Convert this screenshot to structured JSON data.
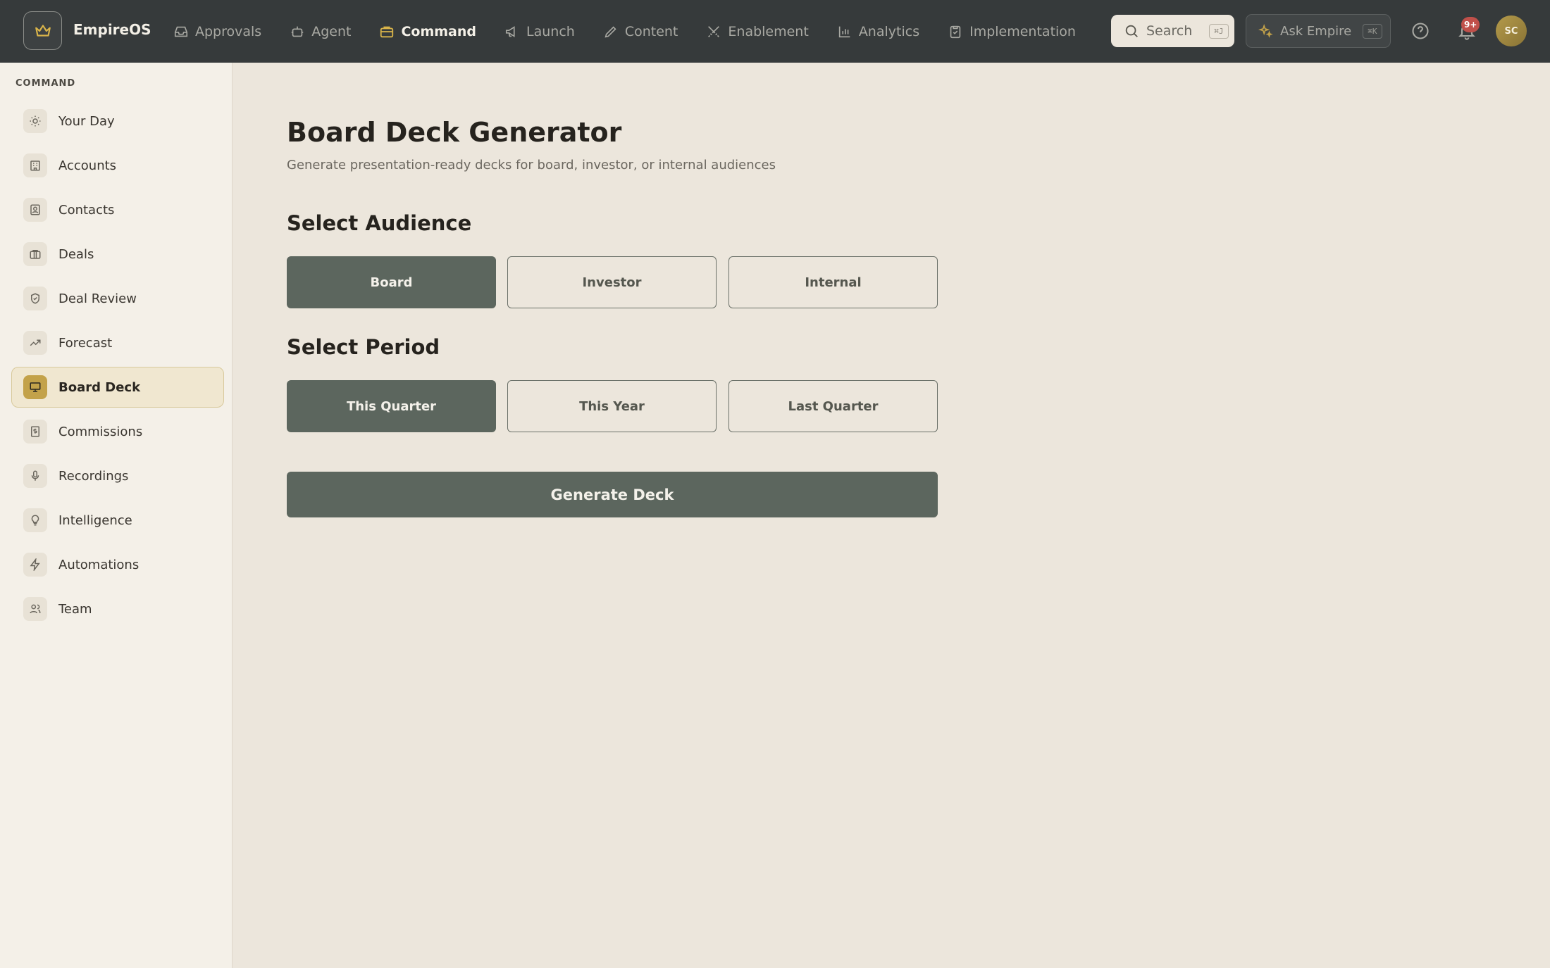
{
  "app": {
    "brand": "EmpireOS"
  },
  "nav": {
    "items": [
      {
        "label": "Approvals",
        "icon": "inbox-icon"
      },
      {
        "label": "Agent",
        "icon": "robot-icon"
      },
      {
        "label": "Command",
        "icon": "briefcase-icon",
        "active": true
      },
      {
        "label": "Launch",
        "icon": "megaphone-icon"
      },
      {
        "label": "Content",
        "icon": "pencil-icon"
      },
      {
        "label": "Enablement",
        "icon": "swords-icon"
      },
      {
        "label": "Analytics",
        "icon": "bar-chart-icon"
      },
      {
        "label": "Implementation",
        "icon": "clipboard-check-icon"
      }
    ]
  },
  "search": {
    "label": "Search",
    "shortcut": "⌘J"
  },
  "ask": {
    "label": "Ask Empire",
    "shortcut": "⌘K"
  },
  "notifications": {
    "badge": "9+"
  },
  "user": {
    "initials": "SC"
  },
  "sidebar": {
    "heading": "COMMAND",
    "items": [
      {
        "label": "Your Day",
        "icon": "sun-icon"
      },
      {
        "label": "Accounts",
        "icon": "building-icon"
      },
      {
        "label": "Contacts",
        "icon": "contact-card-icon"
      },
      {
        "label": "Deals",
        "icon": "briefcase-icon"
      },
      {
        "label": "Deal Review",
        "icon": "shield-check-icon"
      },
      {
        "label": "Forecast",
        "icon": "trending-up-icon"
      },
      {
        "label": "Board Deck",
        "icon": "presentation-icon",
        "active": true
      },
      {
        "label": "Commissions",
        "icon": "dollar-receipt-icon"
      },
      {
        "label": "Recordings",
        "icon": "microphone-icon"
      },
      {
        "label": "Intelligence",
        "icon": "lightbulb-icon"
      },
      {
        "label": "Automations",
        "icon": "lightning-icon"
      },
      {
        "label": "Team",
        "icon": "users-icon"
      }
    ]
  },
  "main": {
    "title": "Board Deck Generator",
    "subtitle": "Generate presentation-ready decks for board, investor, or internal audiences",
    "audience": {
      "heading": "Select Audience",
      "options": [
        "Board",
        "Investor",
        "Internal"
      ],
      "selected": "Board"
    },
    "period": {
      "heading": "Select Period",
      "options": [
        "This Quarter",
        "This Year",
        "Last Quarter"
      ],
      "selected": "This Quarter"
    },
    "generate_label": "Generate Deck"
  },
  "colors": {
    "topbar": "#363a3b",
    "accent_gold": "#c3a24a",
    "selected_option": "#5c665e",
    "background": "#ece6dc",
    "sidebar": "#f4f0e8",
    "badge": "#c0504a"
  }
}
